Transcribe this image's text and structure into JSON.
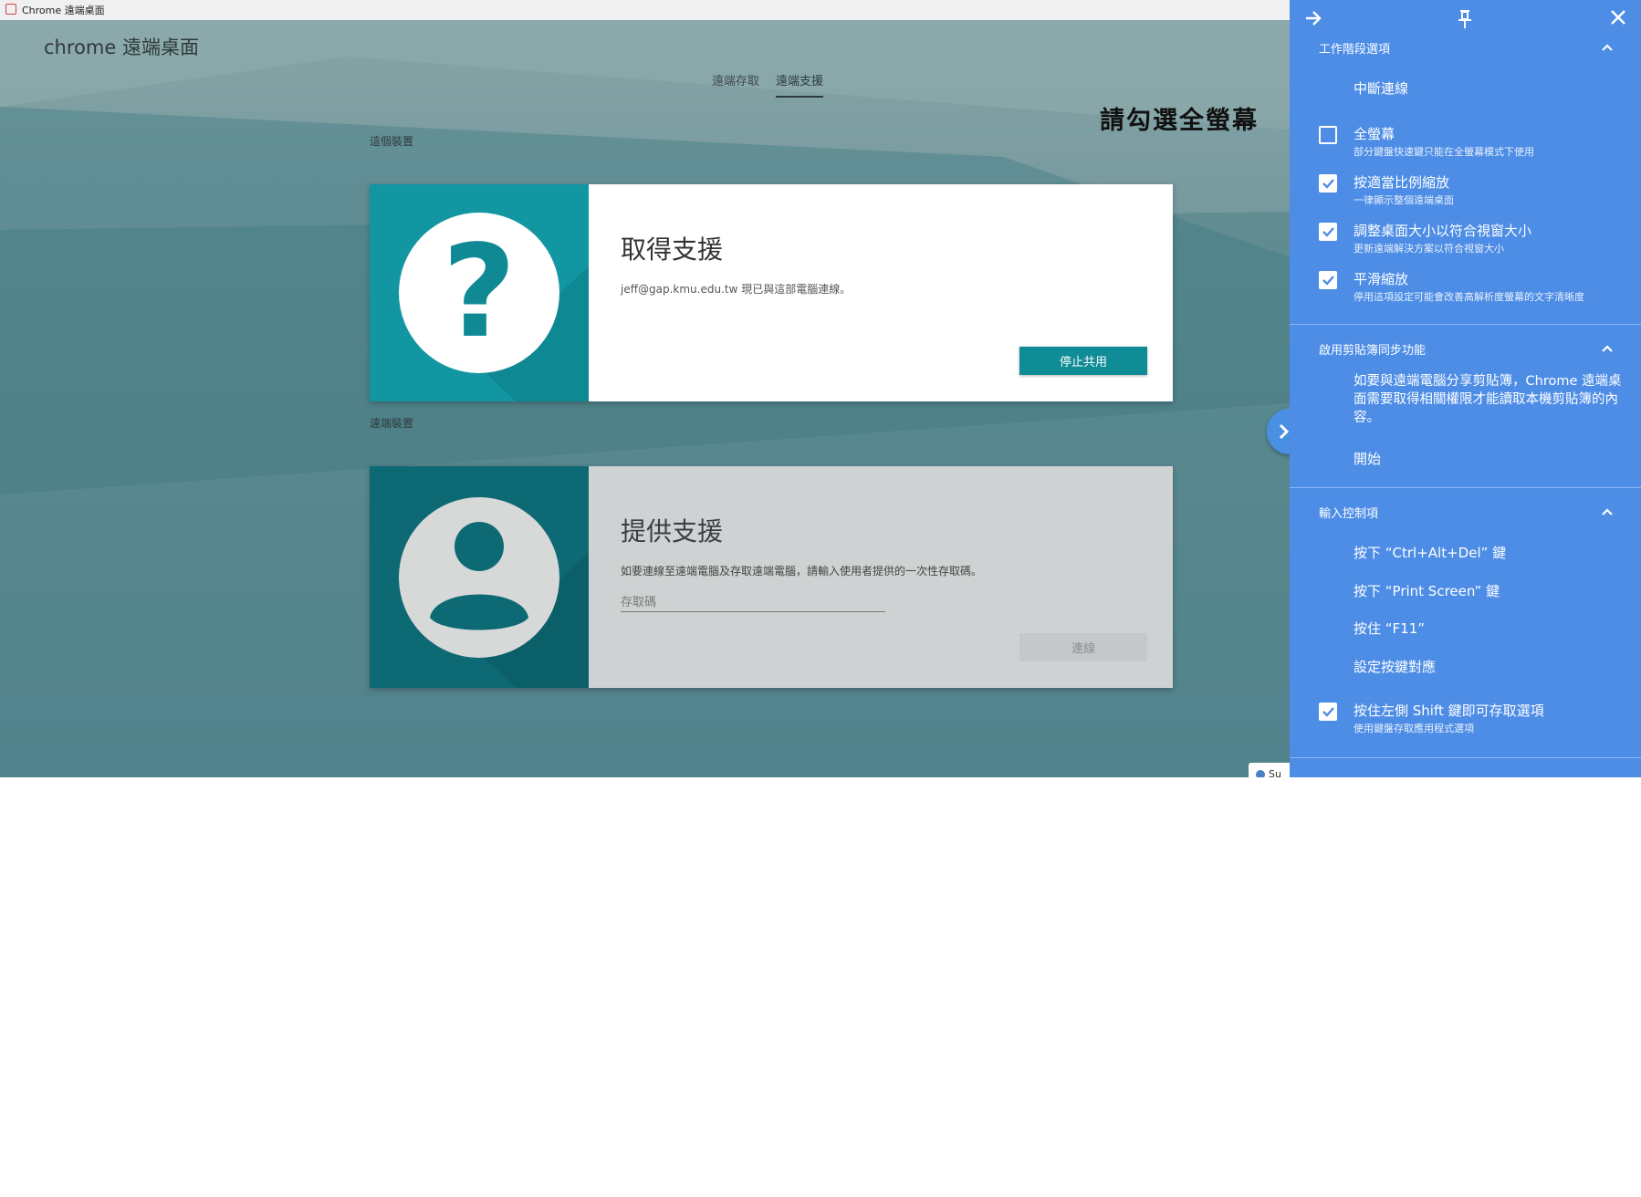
{
  "window": {
    "title": "Chrome 遠端桌面"
  },
  "brand": {
    "prefix": "chrome",
    "name": "遠端桌面"
  },
  "tabs": [
    {
      "label": "遠端存取"
    },
    {
      "label": "遠端支援",
      "active": true
    }
  ],
  "this_device": {
    "section_label": "這個裝置",
    "card_title": "取得支援",
    "description": "jeff@gap.kmu.edu.tw 現已與這部電腦連線。",
    "button": "停止共用"
  },
  "remote_device": {
    "section_label": "遠端裝置",
    "card_title": "提供支援",
    "description": "如要連線至遠端電腦及存取遠端電腦，請輸入使用者提供的一次性存取碼。",
    "code_placeholder": "存取碼",
    "button": "連線"
  },
  "annotation": {
    "text": "請勾選全螢幕"
  },
  "side_panel": {
    "session": {
      "header": "工作階段選項",
      "disconnect": "中斷連線",
      "options": [
        {
          "label": "全螢幕",
          "sub": "部分鍵盤快速鍵只能在全螢幕模式下使用",
          "checked": false
        },
        {
          "label": "按適當比例縮放",
          "sub": "一律顯示整個遠端桌面",
          "checked": true
        },
        {
          "label": "調整桌面大小以符合視窗大小",
          "sub": "更新遠端解決方案以符合視窗大小",
          "checked": true
        },
        {
          "label": "平滑縮放",
          "sub": "停用這項設定可能會改善高解析度螢幕的文字清晰度",
          "checked": true
        }
      ]
    },
    "clipboard": {
      "header": "啟用剪貼簿同步功能",
      "description": "如要與遠端電腦分享剪貼簿，Chrome 遠端桌面需要取得相關權限才能讀取本機剪貼簿的內容。",
      "start": "開始"
    },
    "input": {
      "header": "輸入控制項",
      "items": [
        {
          "label": "按下 “Ctrl+Alt+Del” 鍵"
        },
        {
          "label": "按下 “Print Screen” 鍵"
        },
        {
          "label": "按住 “F11”"
        },
        {
          "label": "設定按鍵對應"
        }
      ],
      "shift_option": {
        "label": "按住左側 Shift 鍵即可存取選項",
        "sub": "使用鍵盤存取應用程式選項",
        "checked": true
      }
    }
  },
  "taskbar_chip": {
    "text": "Su"
  },
  "colors": {
    "panel": "#4d8de6",
    "teal": "#1297a2",
    "teal_dark": "#0d6a74",
    "button": "#108c96"
  }
}
